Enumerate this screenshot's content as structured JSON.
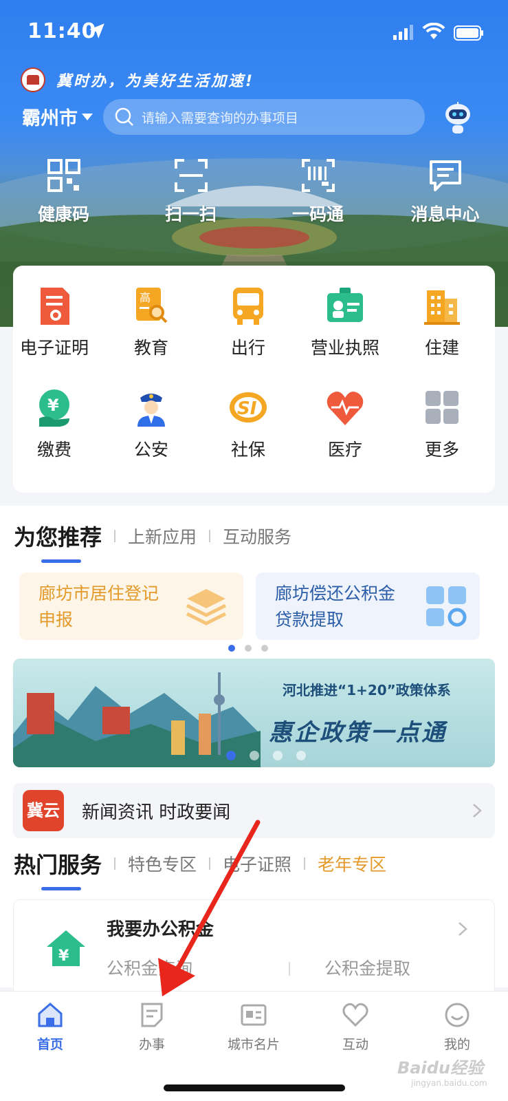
{
  "status_bar": {
    "time": "11:40"
  },
  "header": {
    "slogan": "冀时办，为美好生活加速!",
    "city": "霸州市",
    "search_placeholder": "请输入需要查询的办事项目"
  },
  "quick_actions": [
    {
      "label": "健康码",
      "icon": "health-code-icon"
    },
    {
      "label": "扫一扫",
      "icon": "scan-icon"
    },
    {
      "label": "一码通",
      "icon": "barcode-icon"
    },
    {
      "label": "消息中心",
      "icon": "message-icon"
    }
  ],
  "services": [
    {
      "label": "电子证明",
      "icon": "certificate-icon"
    },
    {
      "label": "教育",
      "icon": "education-icon"
    },
    {
      "label": "出行",
      "icon": "bus-icon"
    },
    {
      "label": "营业执照",
      "icon": "license-icon"
    },
    {
      "label": "住建",
      "icon": "building-icon"
    },
    {
      "label": "缴费",
      "icon": "payment-icon"
    },
    {
      "label": "公安",
      "icon": "police-icon"
    },
    {
      "label": "社保",
      "icon": "social-security-icon"
    },
    {
      "label": "医疗",
      "icon": "medical-heart-icon"
    },
    {
      "label": "更多",
      "icon": "more-grid-icon"
    }
  ],
  "recommend_tabs": [
    "为您推荐",
    "上新应用",
    "互动服务"
  ],
  "recommend_cards": [
    {
      "line1": "廊坊市居住登记",
      "line2": "申报"
    },
    {
      "line1": "廊坊偿还公积金",
      "line2": "贷款提取"
    }
  ],
  "banner": {
    "subtitle": "河北推进“1+20”政策体系",
    "title": "惠企政策一点通"
  },
  "news": {
    "logo": "冀云",
    "text": "新闻资讯 时政要闻"
  },
  "hot_tabs": [
    "热门服务",
    "特色专区",
    "电子证照",
    "老年专区"
  ],
  "hot_item": {
    "title": "我要办公积金",
    "sub1": "公积金查询",
    "sub2": "公积金提取"
  },
  "bottom_nav": [
    {
      "label": "首页",
      "icon": "home-icon"
    },
    {
      "label": "办事",
      "icon": "document-icon"
    },
    {
      "label": "城市名片",
      "icon": "city-card-icon"
    },
    {
      "label": "互动",
      "icon": "heart-icon"
    },
    {
      "label": "我的",
      "icon": "profile-icon"
    }
  ],
  "watermark": {
    "brand": "Baidu经验",
    "domain": "jingyan.baidu.com"
  },
  "colors": {
    "primary": "#3a6ee8",
    "accent_orange": "#e39a2a",
    "hero_blue": "#2f7ef0"
  }
}
